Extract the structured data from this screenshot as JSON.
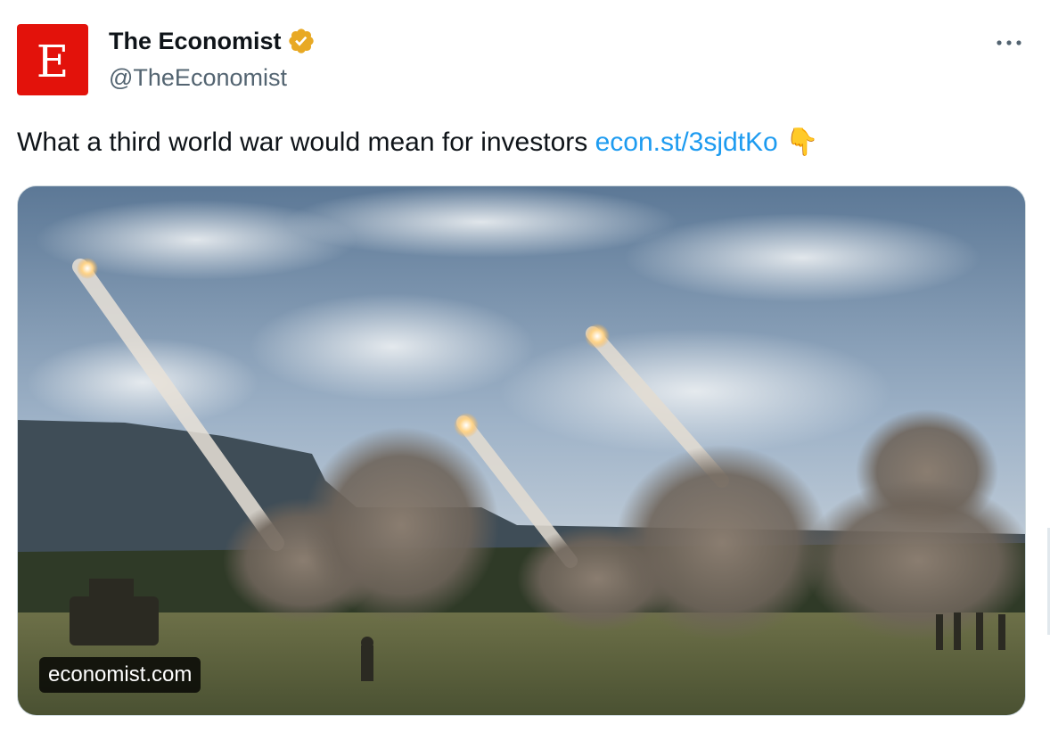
{
  "account": {
    "avatar_letter": "E",
    "display_name": "The Economist",
    "handle": "@TheEconomist",
    "brand_color": "#e3120b",
    "verified_color": "#e8a924"
  },
  "tweet": {
    "text": "What a third world war would mean for investors",
    "link": "econ.st/3sjdtKo",
    "emoji": "👇",
    "link_color": "#1d9bf0"
  },
  "media": {
    "source_label": "economist.com",
    "image_description_icon": "rocket-launch-photo"
  },
  "icons": {
    "more": "more-options-icon",
    "verified": "verified-badge-icon"
  }
}
